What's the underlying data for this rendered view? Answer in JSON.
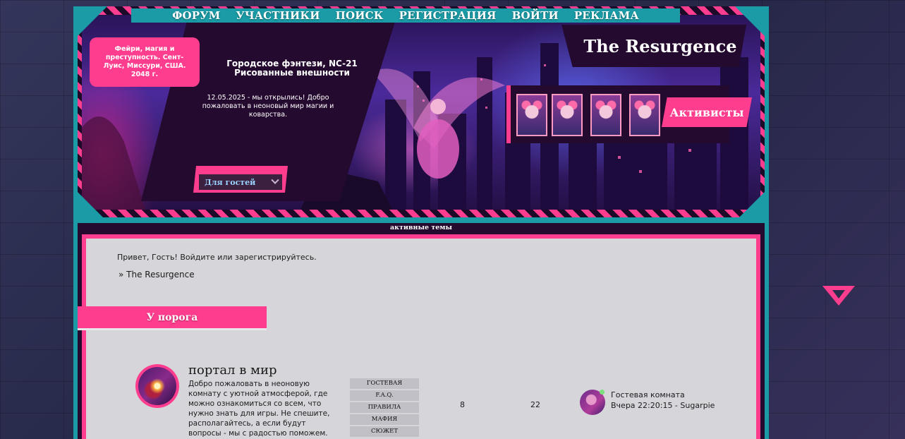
{
  "nav": [
    "ФОРУМ",
    "УЧАСТНИКИ",
    "ПОИСК",
    "РЕГИСТРАЦИЯ",
    "ВОЙТИ",
    "РЕКЛАМА"
  ],
  "header": {
    "tagline": "Фейри, магия и преступность. Сент-Луис, Миссури, США. 2048 г.",
    "genre_line1": "Городское фэнтези, NC-21",
    "genre_line2": "Рисованные внешности",
    "news": "12.05.2025 - мы открылись! Добро пожаловать в неоновый мир магии и коварства.",
    "guest_select": "Для гостей",
    "logo": "The Resurgence",
    "activists_label": "Активисты"
  },
  "main": {
    "active_topics": "активные темы",
    "greeting": "Привет, Гость! Войдите или зарегистрируйтесь.",
    "breadcrumb": "» The Resurgence",
    "category": "У порога"
  },
  "forum": {
    "title": "портал в мир",
    "description": "Добро пожаловать в неоновую комнату с уютной атмосферой, где можно ознакомиться со всем, что нужно знать для игры. Не спешите, располагайтесь, а если будут вопросы - мы с радостью поможем.",
    "sublinks": [
      "ГОСТЕВАЯ",
      "F.A.Q.",
      "ПРАВИЛА",
      "МАФИЯ",
      "СЮЖЕТ"
    ],
    "topics": "8",
    "posts": "22",
    "last_post_title": "Гостевая комната",
    "last_post_meta": "Вчера 22:20:15 - Sugarpie"
  },
  "colors": {
    "teal": "#1a9ba6",
    "pink": "#ff3d8e",
    "dark": "#240a2e",
    "panel": "#d6d5da"
  }
}
